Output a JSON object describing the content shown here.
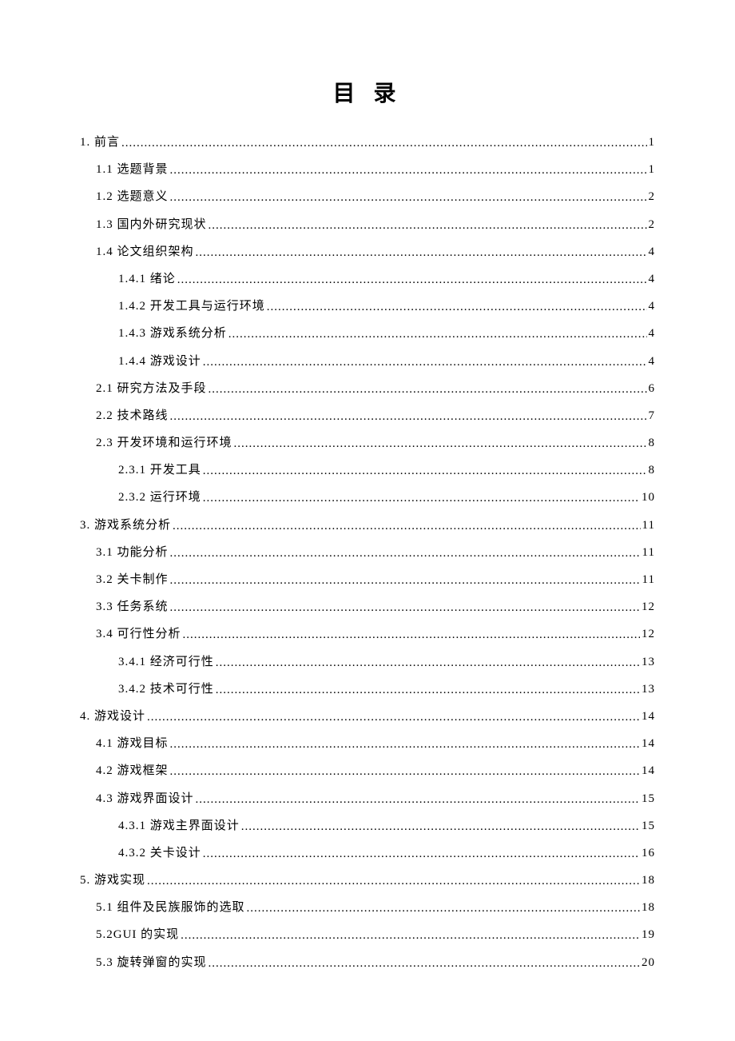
{
  "title": "目 录",
  "entries": [
    {
      "label": "1. 前言",
      "page": "1",
      "indent": 0
    },
    {
      "label": "1.1 选题背景",
      "page": "1",
      "indent": 1
    },
    {
      "label": "1.2 选题意义",
      "page": "2",
      "indent": 1
    },
    {
      "label": "1.3 国内外研究现状",
      "page": "2",
      "indent": 1
    },
    {
      "label": "1.4 论文组织架构",
      "page": "4",
      "indent": 1
    },
    {
      "label": "1.4.1 绪论",
      "page": "4",
      "indent": 2
    },
    {
      "label": "1.4.2 开发工具与运行环境",
      "page": "4",
      "indent": 2
    },
    {
      "label": "1.4.3 游戏系统分析",
      "page": "4",
      "indent": 2
    },
    {
      "label": "1.4.4 游戏设计",
      "page": "4",
      "indent": 2
    },
    {
      "label": "2.1 研究方法及手段",
      "page": "6",
      "indent": 1
    },
    {
      "label": "2.2 技术路线",
      "page": "7",
      "indent": 1
    },
    {
      "label": "2.3 开发环境和运行环境",
      "page": "8",
      "indent": 1
    },
    {
      "label": "2.3.1 开发工具",
      "page": "8",
      "indent": 2
    },
    {
      "label": "2.3.2 运行环境",
      "page": "10",
      "indent": 2
    },
    {
      "label": "3. 游戏系统分析",
      "page": "11",
      "indent": 0
    },
    {
      "label": "3.1 功能分析",
      "page": "11",
      "indent": 1
    },
    {
      "label": "3.2 关卡制作",
      "page": "11",
      "indent": 1
    },
    {
      "label": "3.3 任务系统",
      "page": "12",
      "indent": 1
    },
    {
      "label": "3.4 可行性分析",
      "page": "12",
      "indent": 1
    },
    {
      "label": "3.4.1 经济可行性",
      "page": "13",
      "indent": 2
    },
    {
      "label": "3.4.2 技术可行性",
      "page": "13",
      "indent": 2
    },
    {
      "label": "4. 游戏设计",
      "page": "14",
      "indent": 0
    },
    {
      "label": "4.1 游戏目标",
      "page": "14",
      "indent": 1
    },
    {
      "label": "4.2 游戏框架",
      "page": "14",
      "indent": 1
    },
    {
      "label": "4.3 游戏界面设计",
      "page": "15",
      "indent": 1
    },
    {
      "label": "4.3.1 游戏主界面设计",
      "page": "15",
      "indent": 2
    },
    {
      "label": "4.3.2 关卡设计",
      "page": "16",
      "indent": 2
    },
    {
      "label": "5. 游戏实现",
      "page": "18",
      "indent": 0
    },
    {
      "label": "5.1 组件及民族服饰的选取",
      "page": "18",
      "indent": 1
    },
    {
      "label": "5.2GUI 的实现",
      "page": "19",
      "indent": 1
    },
    {
      "label": "5.3 旋转弹窗的实现",
      "page": "20",
      "indent": 1
    }
  ]
}
